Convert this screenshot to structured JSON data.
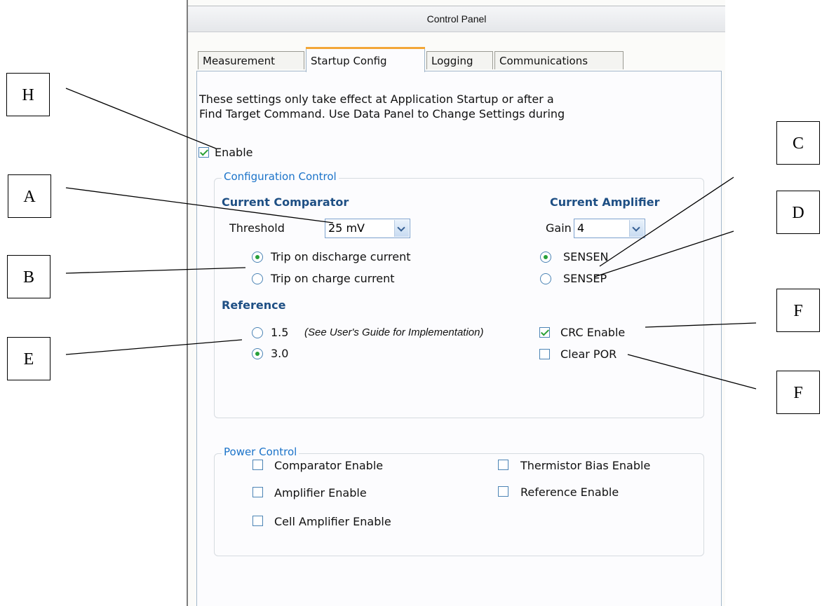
{
  "window": {
    "title": "Control Panel"
  },
  "tabs": [
    {
      "label": "Measurement",
      "active": false
    },
    {
      "label": "Startup Config",
      "active": true
    },
    {
      "label": "Logging",
      "active": false
    },
    {
      "label": "Communications",
      "active": false
    }
  ],
  "info_text": "These settings only take effect at Application Startup or after a\nFind Target Command. Use Data Panel to Change Settings during",
  "enable": {
    "label": "Enable",
    "checked": true
  },
  "configuration_control": {
    "title": "Configuration Control",
    "current_comparator": {
      "header": "Current Comparator",
      "threshold_label": "Threshold",
      "threshold_value": "25 mV",
      "options": [
        {
          "label": "Trip on discharge current",
          "selected": true
        },
        {
          "label": "Trip on charge current",
          "selected": false
        }
      ]
    },
    "current_amplifier": {
      "header": "Current Amplifier",
      "gain_label": "Gain",
      "gain_value": "4",
      "options": [
        {
          "label": "SENSEN",
          "selected": true
        },
        {
          "label": "SENSEP",
          "selected": false
        }
      ]
    },
    "reference": {
      "header": "Reference",
      "options": [
        {
          "label": "1.5",
          "note": "(See User's Guide for Implementation)",
          "selected": false
        },
        {
          "label": "3.0",
          "selected": true
        }
      ]
    },
    "crc_enable": {
      "label": "CRC Enable",
      "checked": true
    },
    "clear_por": {
      "label": "Clear POR",
      "checked": false
    }
  },
  "power_control": {
    "title": "Power Control",
    "items": [
      {
        "label": "Comparator Enable",
        "checked": false
      },
      {
        "label": "Amplifier Enable",
        "checked": false
      },
      {
        "label": "Cell Amplifier Enable",
        "checked": false
      },
      {
        "label": "Thermistor Bias Enable",
        "checked": false
      },
      {
        "label": "Reference Enable",
        "checked": false
      }
    ]
  },
  "callouts": {
    "h": "H",
    "a": "A",
    "b": "B",
    "e": "E",
    "c": "C",
    "d": "D",
    "f1": "F",
    "f2": "F"
  }
}
